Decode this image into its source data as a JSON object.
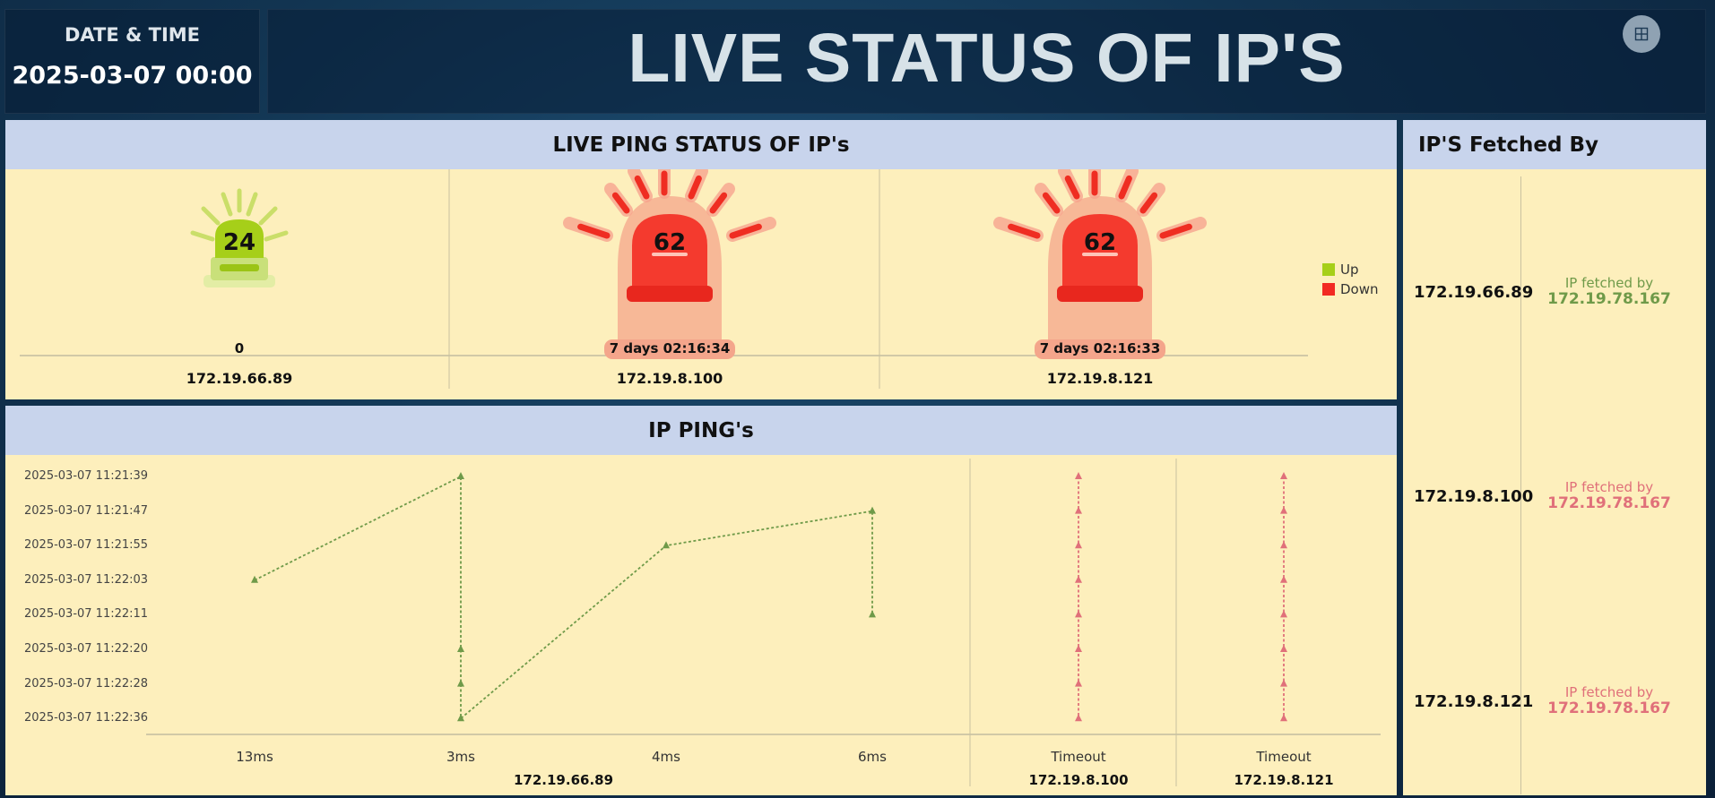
{
  "header": {
    "clock_title": "DATE & TIME",
    "clock_value": "2025-03-07 00:00",
    "main_title": "LIVE STATUS OF IP'S",
    "grid_icon": "grid-icon"
  },
  "status_panel": {
    "title": "LIVE PING STATUS OF IP's",
    "items": [
      {
        "ip": "172.19.66.89",
        "count": "24",
        "uptime": "0",
        "state": "up"
      },
      {
        "ip": "172.19.8.100",
        "count": "62",
        "uptime": "7 days 02:16:34",
        "state": "down"
      },
      {
        "ip": "172.19.8.121",
        "count": "62",
        "uptime": "7 days 02:16:33",
        "state": "down"
      }
    ],
    "legend": [
      {
        "label": "Up",
        "color": "#a6cf19"
      },
      {
        "label": "Down",
        "color": "#f22a22"
      }
    ]
  },
  "ping_panel": {
    "title": "IP PING's",
    "chart_data": {
      "type": "line",
      "y_categories": [
        "2025-03-07 11:21:39",
        "2025-03-07 11:21:47",
        "2025-03-07 11:21:55",
        "2025-03-07 11:22:03",
        "2025-03-07 11:22:11",
        "2025-03-07 11:22:20",
        "2025-03-07 11:22:28",
        "2025-03-07 11:22:36"
      ],
      "groups": [
        {
          "ip": "172.19.66.89",
          "color": "#6f9a49",
          "categories": [
            "13ms",
            "3ms",
            "4ms",
            "6ms"
          ]
        },
        {
          "ip": "172.19.8.100",
          "color": "#e0707a",
          "categories": [
            "Timeout"
          ]
        },
        {
          "ip": "172.19.8.121",
          "color": "#e0707a",
          "categories": [
            "Timeout"
          ]
        }
      ],
      "series": [
        {
          "ip": "172.19.66.89",
          "points": [
            {
              "x": "13ms",
              "y": "2025-03-07 11:22:03"
            },
            {
              "x": "3ms",
              "y": "2025-03-07 11:21:39"
            },
            {
              "x": "3ms",
              "y": "2025-03-07 11:22:20"
            },
            {
              "x": "3ms",
              "y": "2025-03-07 11:22:28"
            },
            {
              "x": "3ms",
              "y": "2025-03-07 11:22:36"
            },
            {
              "x": "4ms",
              "y": "2025-03-07 11:21:55"
            },
            {
              "x": "6ms",
              "y": "2025-03-07 11:21:47"
            },
            {
              "x": "6ms",
              "y": "2025-03-07 11:22:11"
            }
          ]
        },
        {
          "ip": "172.19.8.100",
          "points": [
            {
              "x": "Timeout",
              "y": "2025-03-07 11:21:39"
            },
            {
              "x": "Timeout",
              "y": "2025-03-07 11:21:47"
            },
            {
              "x": "Timeout",
              "y": "2025-03-07 11:21:55"
            },
            {
              "x": "Timeout",
              "y": "2025-03-07 11:22:03"
            },
            {
              "x": "Timeout",
              "y": "2025-03-07 11:22:11"
            },
            {
              "x": "Timeout",
              "y": "2025-03-07 11:22:20"
            },
            {
              "x": "Timeout",
              "y": "2025-03-07 11:22:28"
            },
            {
              "x": "Timeout",
              "y": "2025-03-07 11:22:36"
            }
          ]
        },
        {
          "ip": "172.19.8.121",
          "points": [
            {
              "x": "Timeout",
              "y": "2025-03-07 11:21:39"
            },
            {
              "x": "Timeout",
              "y": "2025-03-07 11:21:47"
            },
            {
              "x": "Timeout",
              "y": "2025-03-07 11:21:55"
            },
            {
              "x": "Timeout",
              "y": "2025-03-07 11:22:03"
            },
            {
              "x": "Timeout",
              "y": "2025-03-07 11:22:11"
            },
            {
              "x": "Timeout",
              "y": "2025-03-07 11:22:20"
            },
            {
              "x": "Timeout",
              "y": "2025-03-07 11:22:28"
            },
            {
              "x": "Timeout",
              "y": "2025-03-07 11:22:36"
            }
          ]
        }
      ]
    }
  },
  "fetch_panel": {
    "title": "IP'S Fetched By",
    "rows": [
      {
        "ip": "172.19.66.89",
        "label": "IP fetched by",
        "value": "172.19.78.167",
        "color": "#6f9a49"
      },
      {
        "ip": "172.19.8.100",
        "label": "IP fetched by",
        "value": "172.19.78.167",
        "color": "#e0707a"
      },
      {
        "ip": "172.19.8.121",
        "label": "IP fetched by",
        "value": "172.19.78.167",
        "color": "#e0707a"
      }
    ]
  }
}
